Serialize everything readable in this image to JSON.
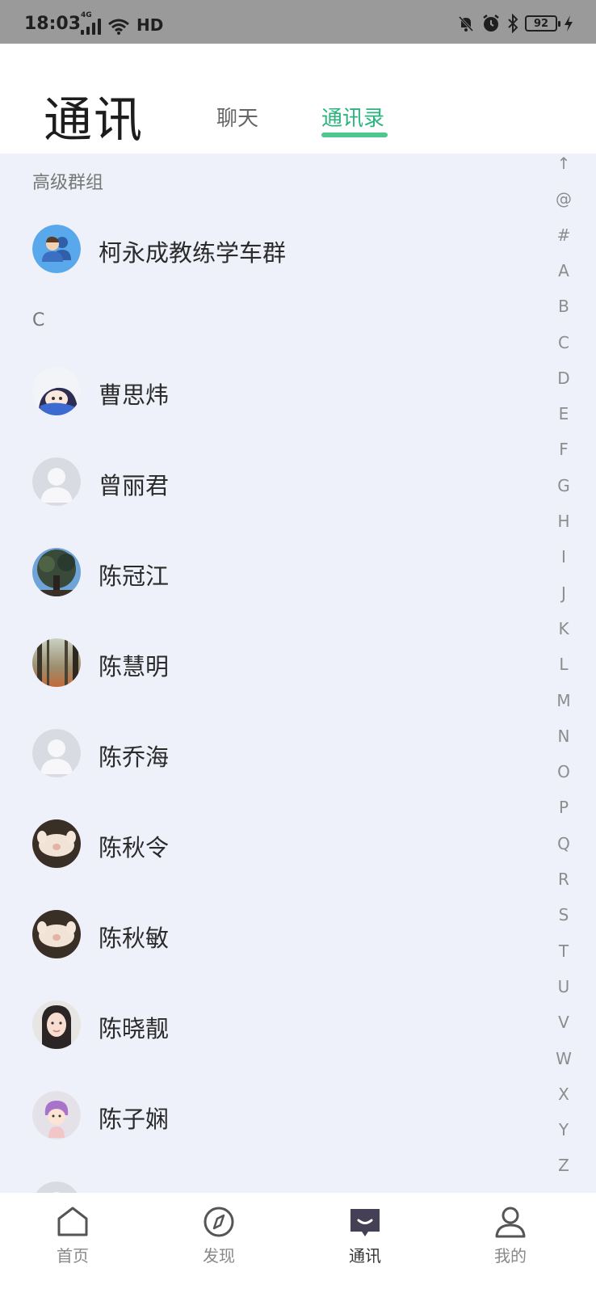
{
  "status_bar": {
    "time": "18:03",
    "network": "4G",
    "wifi_label": "HD",
    "battery": "92"
  },
  "header": {
    "title": "通讯",
    "tabs": [
      {
        "label": "聊天",
        "active": false
      },
      {
        "label": "通讯录",
        "active": true
      }
    ]
  },
  "sections": [
    {
      "title": "高级群组",
      "items": [
        {
          "name": "柯永成教练学车群",
          "avatar": "group-icon"
        }
      ]
    },
    {
      "title": "C",
      "items": [
        {
          "name": "曹思炜",
          "avatar": "anime-avatar"
        },
        {
          "name": "曾丽君",
          "avatar": "default-avatar"
        },
        {
          "name": "陈冠江",
          "avatar": "tree-avatar"
        },
        {
          "name": "陈慧明",
          "avatar": "forest-avatar"
        },
        {
          "name": "陈乔海",
          "avatar": "default-avatar"
        },
        {
          "name": "陈秋令",
          "avatar": "pet-avatar"
        },
        {
          "name": "陈秋敏",
          "avatar": "pet-avatar"
        },
        {
          "name": "陈晓靓",
          "avatar": "photo-avatar"
        },
        {
          "name": "陈子娴",
          "avatar": "cartoon-avatar"
        }
      ]
    }
  ],
  "index": [
    "↑",
    "@",
    "#",
    "A",
    "B",
    "C",
    "D",
    "E",
    "F",
    "G",
    "H",
    "I",
    "J",
    "K",
    "L",
    "M",
    "N",
    "O",
    "P",
    "Q",
    "R",
    "S",
    "T",
    "U",
    "V",
    "W",
    "X",
    "Y",
    "Z"
  ],
  "bottom_nav": [
    {
      "label": "首页",
      "icon": "home-icon",
      "active": false
    },
    {
      "label": "发现",
      "icon": "compass-icon",
      "active": false
    },
    {
      "label": "通讯",
      "icon": "chat-icon",
      "active": true
    },
    {
      "label": "我的",
      "icon": "user-icon",
      "active": false
    }
  ],
  "colors": {
    "accent": "#2ab47e",
    "background": "#eef1fa",
    "status_bar": "#9a9a9a"
  }
}
